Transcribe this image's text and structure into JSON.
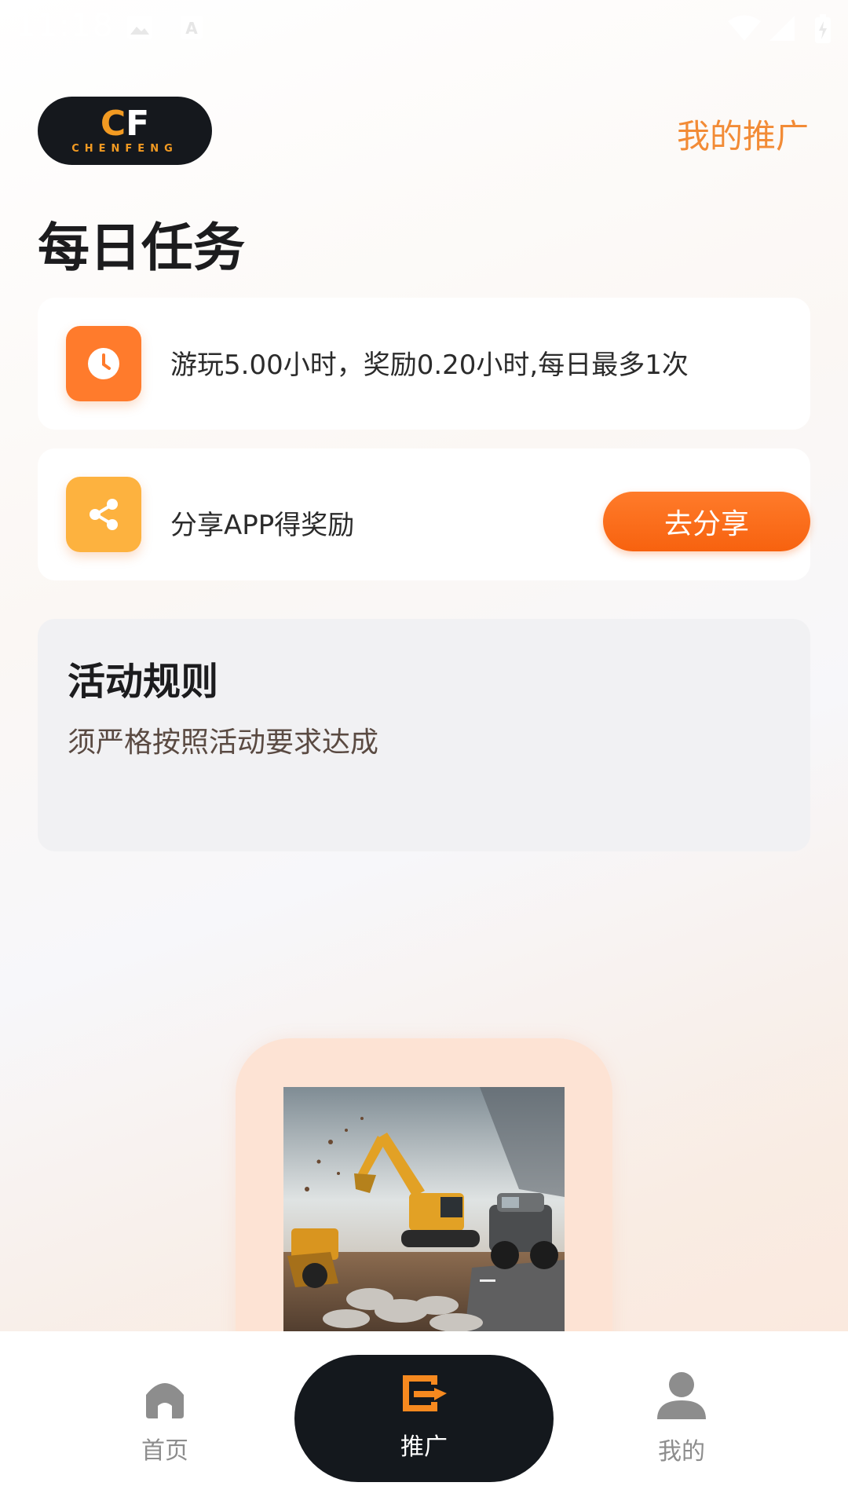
{
  "status_bar": {
    "time": "11:18"
  },
  "header": {
    "my_promotion": "我的推广"
  },
  "logo": {
    "mark_left": "C",
    "mark_right": "F",
    "wordmark": "CHENFENG"
  },
  "page_title": "每日任务",
  "tasks": [
    {
      "icon": "clock-icon",
      "text": "游玩5.00小时，奖励0.20小时,每日最多1次"
    },
    {
      "icon": "share-icon",
      "text": "分享APP得奖励",
      "button": "去分享"
    }
  ],
  "rules": {
    "title": "活动规则",
    "text": "须严格按照活动要求达成"
  },
  "nav": {
    "items": [
      {
        "label": "首页",
        "icon": "home-icon"
      },
      {
        "label": "推广",
        "icon": "promo-share-icon",
        "active": true
      },
      {
        "label": "我的",
        "icon": "user-icon"
      }
    ]
  },
  "colors": {
    "accent": "#F7620F",
    "accent_text": "#F28B36",
    "dark": "#14181D",
    "share_icon_bg": "#FDB23F"
  }
}
